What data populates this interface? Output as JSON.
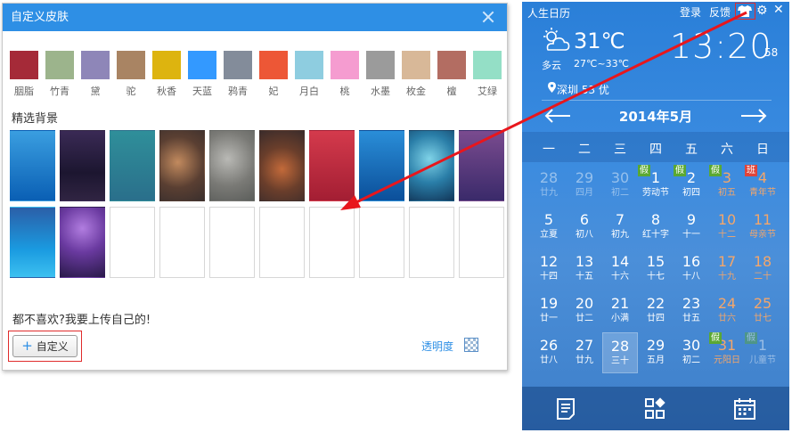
{
  "skin_dialog": {
    "title": "自定义皮肤",
    "swatches": [
      {
        "name": "胭脂",
        "color": "#a52a38"
      },
      {
        "name": "竹青",
        "color": "#9cb48c"
      },
      {
        "name": "黛",
        "color": "#8e86b8"
      },
      {
        "name": "驼",
        "color": "#a98463"
      },
      {
        "name": "秋香",
        "color": "#ddb40f"
      },
      {
        "name": "天蓝",
        "color": "#3399ff"
      },
      {
        "name": "鸦青",
        "color": "#838c9a"
      },
      {
        "name": "妃",
        "color": "#ed5736"
      },
      {
        "name": "月白",
        "color": "#8ecde0"
      },
      {
        "name": "桃",
        "color": "#f59cd0"
      },
      {
        "name": "水墨",
        "color": "#9b9b9b"
      },
      {
        "name": "枚金",
        "color": "#d8b898"
      },
      {
        "name": "檀",
        "color": "#b36d62"
      },
      {
        "name": "艾绿",
        "color": "#94dfc6"
      }
    ],
    "section_label": "精选背景",
    "backgrounds": [
      {
        "name": "bg-blue-gradient",
        "fill": "linear-gradient(180deg,#3a9ee0,#0a5fb4)"
      },
      {
        "name": "bg-dark-purple",
        "fill": "linear-gradient(180deg,#3a2a55,#1c1630 60%,#302442)"
      },
      {
        "name": "bg-teal",
        "fill": "linear-gradient(180deg,#2f8f9a,#2a6f8b)"
      },
      {
        "name": "bg-blurred-brown",
        "fill": "radial-gradient(circle at 40% 45%,#c28a5e,#5a3f32 55%,#3a2f2d)"
      },
      {
        "name": "bg-blurred-gray",
        "fill": "radial-gradient(circle at 40% 40%,#b9b9b5,#7a7a76 55%,#5c5e5b)"
      },
      {
        "name": "bg-blurred-warm",
        "fill": "radial-gradient(circle at 50% 55%,#c36a3a,#6a3e2b 50%,#3b2c2b)"
      },
      {
        "name": "bg-crimson",
        "fill": "linear-gradient(180deg,#d43a4c,#a31e33)"
      },
      {
        "name": "bg-ocean-blue",
        "fill": "linear-gradient(180deg,#2a8ed8,#0b4f9a)"
      },
      {
        "name": "bg-teal-light",
        "fill": "radial-gradient(circle at 45% 40%,#7fd3e8,#2a7ea8 50%,#12375a)"
      },
      {
        "name": "bg-purple-gradient",
        "fill": "linear-gradient(180deg,#7a4b8f,#3a2a6a)"
      },
      {
        "name": "bg-blue-sky",
        "fill": "linear-gradient(180deg,#2b5fa8,#1a9ae0 60%,#3cc0f0)"
      },
      {
        "name": "bg-violet-glow",
        "fill": "radial-gradient(circle at 50% 30%,#b17de0,#6a3aa0 45%,#2a1a4a)"
      },
      {
        "name": "bg-empty-1",
        "fill": "#ffffff"
      },
      {
        "name": "bg-empty-2",
        "fill": "#ffffff"
      },
      {
        "name": "bg-empty-3",
        "fill": "#ffffff"
      },
      {
        "name": "bg-empty-4",
        "fill": "#ffffff"
      },
      {
        "name": "bg-empty-5",
        "fill": "#ffffff"
      },
      {
        "name": "bg-empty-6",
        "fill": "#ffffff"
      },
      {
        "name": "bg-empty-7",
        "fill": "#ffffff"
      },
      {
        "name": "bg-empty-8",
        "fill": "#ffffff"
      }
    ],
    "upload_hint": "都不喜欢?我要上传自己的!",
    "custom_label": "自定义",
    "opacity_label": "透明度"
  },
  "calendar": {
    "title": "人生日历",
    "login": "登录",
    "feedback": "反馈",
    "temperature": "31℃",
    "condition": "多云",
    "range": "27℃~33℃",
    "time": "13:20",
    "seconds": "58",
    "location": "深圳 53 优",
    "month": "2014年5月",
    "weekdays": [
      "一",
      "二",
      "三",
      "四",
      "五",
      "六",
      "日"
    ],
    "rows": [
      [
        {
          "n": "28",
          "l": "廿九",
          "dim": true
        },
        {
          "n": "29",
          "l": "四月",
          "dim": true
        },
        {
          "n": "30",
          "l": "初二",
          "dim": true
        },
        {
          "n": "1",
          "l": "劳动节",
          "badge": "假"
        },
        {
          "n": "2",
          "l": "初四",
          "badge": "假"
        },
        {
          "n": "3",
          "l": "初五",
          "badge": "假",
          "wkend": true
        },
        {
          "n": "4",
          "l": "青年节",
          "badge": "班",
          "wkend": true
        }
      ],
      [
        {
          "n": "5",
          "l": "立夏"
        },
        {
          "n": "6",
          "l": "初八"
        },
        {
          "n": "7",
          "l": "初九"
        },
        {
          "n": "8",
          "l": "红十字"
        },
        {
          "n": "9",
          "l": "十一"
        },
        {
          "n": "10",
          "l": "十二",
          "wkend": true
        },
        {
          "n": "11",
          "l": "母亲节",
          "wkend": true
        }
      ],
      [
        {
          "n": "12",
          "l": "十四"
        },
        {
          "n": "13",
          "l": "十五"
        },
        {
          "n": "14",
          "l": "十六"
        },
        {
          "n": "15",
          "l": "十七"
        },
        {
          "n": "16",
          "l": "十八"
        },
        {
          "n": "17",
          "l": "十九",
          "wkend": true
        },
        {
          "n": "18",
          "l": "二十",
          "wkend": true
        }
      ],
      [
        {
          "n": "19",
          "l": "廿一"
        },
        {
          "n": "20",
          "l": "廿二"
        },
        {
          "n": "21",
          "l": "小满"
        },
        {
          "n": "22",
          "l": "廿四"
        },
        {
          "n": "23",
          "l": "廿五"
        },
        {
          "n": "24",
          "l": "廿六",
          "wkend": true
        },
        {
          "n": "25",
          "l": "廿七",
          "wkend": true
        }
      ],
      [
        {
          "n": "26",
          "l": "廿八"
        },
        {
          "n": "27",
          "l": "廿九"
        },
        {
          "n": "28",
          "l": "三十",
          "today": true
        },
        {
          "n": "29",
          "l": "五月"
        },
        {
          "n": "30",
          "l": "初二"
        },
        {
          "n": "31",
          "l": "元阳日",
          "badge": "假",
          "wkend": true
        },
        {
          "n": "1",
          "l": "儿童节",
          "badge": "假",
          "dim": true
        }
      ]
    ]
  },
  "colors": {
    "accent": "#2e8fe5",
    "highlight": "#e02b2b",
    "weekend": "#f3a66b",
    "holiday_badge": "#5aa832",
    "work_badge": "#e0443a"
  },
  "icons": [
    "close-icon",
    "plus-icon",
    "opacity-icon",
    "skin-icon",
    "gear-icon",
    "cloud-sun-icon",
    "location-pin-icon",
    "arrow-left-icon",
    "arrow-right-icon",
    "notes-icon",
    "apps-icon",
    "calendar-icon"
  ]
}
